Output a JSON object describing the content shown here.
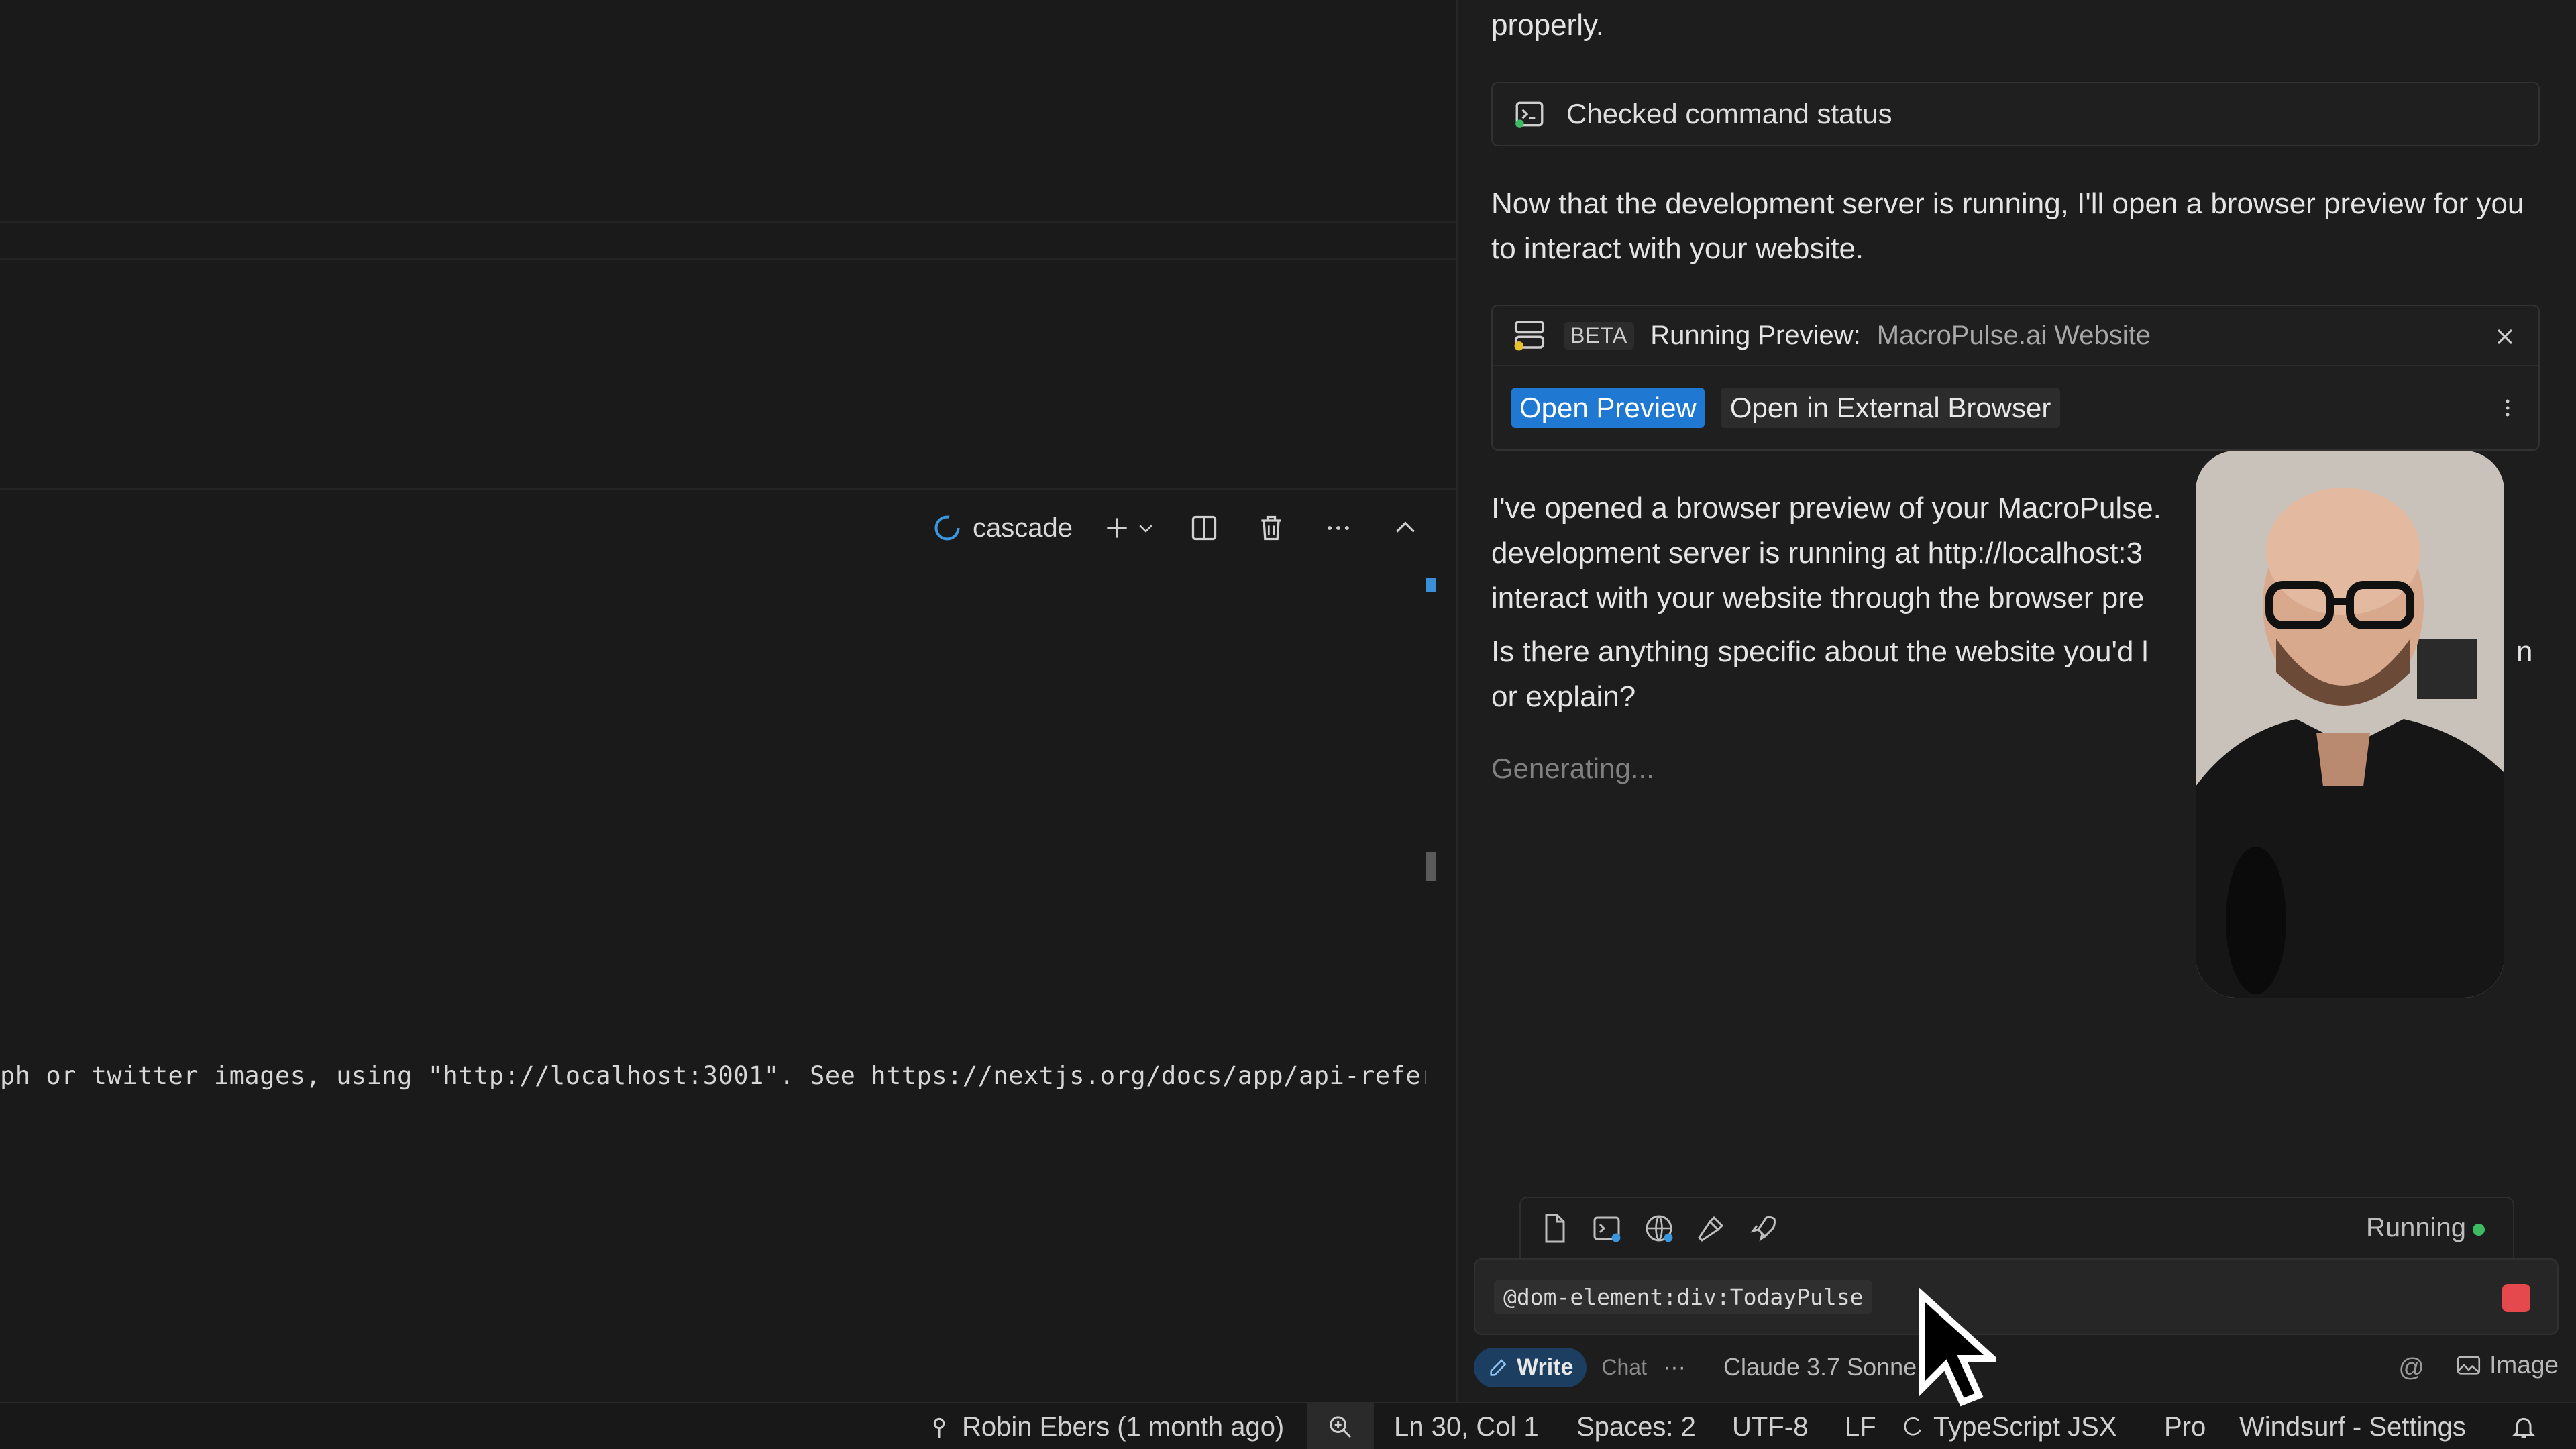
{
  "terminal": {
    "name": "cascade",
    "output_line": "ph or twitter images, using \"http://localhost:3001\". See https://nextjs.org/docs/app/api-refer"
  },
  "cascade": {
    "top_text": "properly.",
    "checked_status": "Checked command status",
    "message1": "Now that the development server is running, I'll open a browser preview for you to interact with your website.",
    "preview": {
      "badge": "BETA",
      "label": "Running Preview:",
      "name": "MacroPulse.ai Website",
      "open_preview": "Open Preview",
      "open_external": "Open in External Browser"
    },
    "message2_lines": [
      "I've opened a browser preview of your MacroPulse.",
      "development server is running at http://localhost:3",
      "interact with your website through the browser pre"
    ],
    "message3_lines": [
      "Is there anything specific about the website you'd l",
      "or explain?"
    ],
    "message3_tail": "n",
    "generating": "Generating...",
    "running_label": "Running",
    "input_mention": "@dom-element:div:TodayPulse",
    "mode": {
      "write": "Write",
      "chat": "Chat",
      "more": "···"
    },
    "model": "Claude 3.7 Sonne",
    "image_label": "Image"
  },
  "statusbar": {
    "git": "Robin Ebers (1 month ago)",
    "position": "Ln 30, Col 1",
    "spaces": "Spaces: 2",
    "encoding": "UTF-8",
    "eol": "LF",
    "language": "TypeScript JSX",
    "plan": "Pro",
    "settings": "Windsurf - Settings"
  }
}
